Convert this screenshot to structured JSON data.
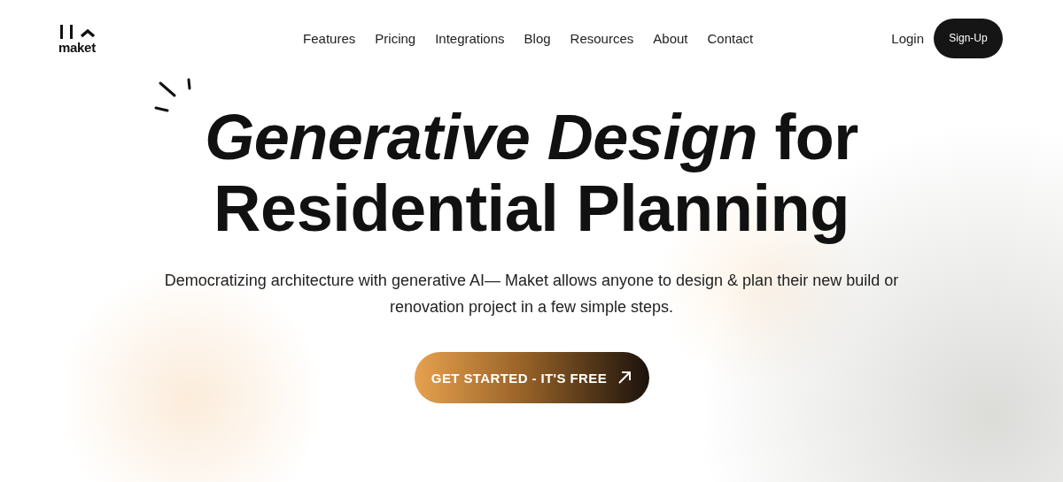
{
  "logo": {
    "text": "maket"
  },
  "nav": {
    "links": [
      "Features",
      "Pricing",
      "Integrations",
      "Blog",
      "Resources",
      "About",
      "Contact"
    ],
    "login": "Login",
    "signup": "Sign-Up"
  },
  "hero": {
    "headline_line_1": "*Generative Design* for",
    "headline_line_2": "Residential Planning",
    "subtitle": "Democratizing architecture with generative AI— Maket allows anyone to design & plan their new build or renovation project in a few simple steps.",
    "cta": "GET STARTED - IT'S FREE"
  }
}
